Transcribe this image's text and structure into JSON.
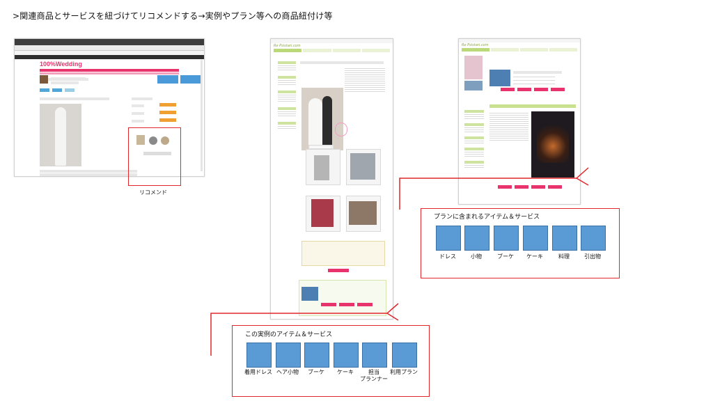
{
  "heading": ">関連商品とサービスを紐づけてリコメンドする→実例やプラン等への商品紐付け等",
  "screenshot1": {
    "brand": "100%Wedding",
    "caption": "リコメンド"
  },
  "screenshot2": {
    "brand": "Re Psistari.com"
  },
  "screenshot3": {
    "brand": "Re Psistari.com"
  },
  "plan_box": {
    "title": "プランに含まれるアイテム＆サービス",
    "items": [
      "ドレス",
      "小物",
      "ブーケ",
      "ケーキ",
      "料理",
      "引出物"
    ]
  },
  "example_box": {
    "title": "この実例のアイテム＆サービス",
    "items": [
      "着用ドレス",
      "ヘア小物",
      "ブーケ",
      "ケーキ",
      "担当\nプランナー",
      "利用プラン"
    ]
  }
}
